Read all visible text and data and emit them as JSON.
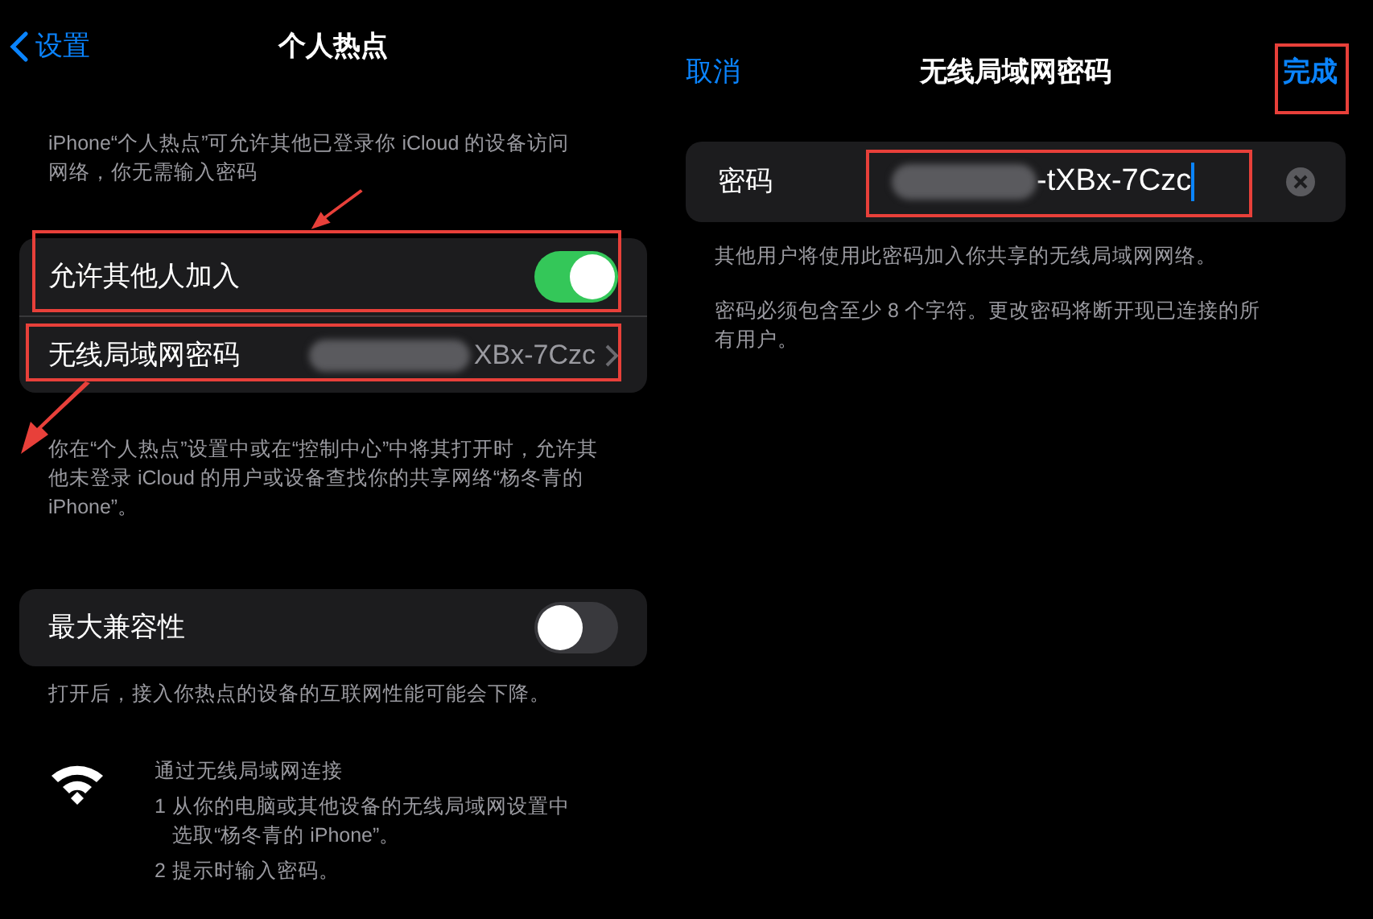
{
  "left_screen": {
    "nav": {
      "back": "设置",
      "title": "个人热点"
    },
    "intro": "iPhone“个人热点”可允许其他已登录你 iCloud 的设备访问网络，你无需输入密码",
    "settings_group": [
      {
        "kind": "toggle",
        "label": "允许其他人加入",
        "on": true
      },
      {
        "kind": "link",
        "label": "无线局域网密码",
        "value": "XBx-7Czc"
      }
    ],
    "group_footer": "你在“个人热点”设置中或在“控制中心”中将其打开时，允许其他未登录 iCloud 的用户或设备查找你的共享网络“杨冬青的 iPhone”。",
    "compat": {
      "label": "最大兼容性",
      "on": false
    },
    "compat_footer": "打开后，接入你热点的设备的互联网性能可能会下降。",
    "wifi_help": {
      "title": "通过无线局域网连接",
      "steps": [
        {
          "number": "1",
          "text": "从你的电脑或其他设备的无线局域网设置中选取“杨冬青的 iPhone”。"
        },
        {
          "number": "2",
          "text": "提示时输入密码。"
        }
      ]
    }
  },
  "right_screen": {
    "nav": {
      "cancel": "取消",
      "title": "无线局域网密码",
      "done": "完成"
    },
    "password_field": {
      "label": "密码",
      "value": "-tXBx-7Czc"
    },
    "notes": [
      "其他用户将使用此密码加入你共享的无线局域网网络。",
      "密码必须包含至少 8 个字符。更改密码将断开现已连接的所有用户。"
    ]
  }
}
